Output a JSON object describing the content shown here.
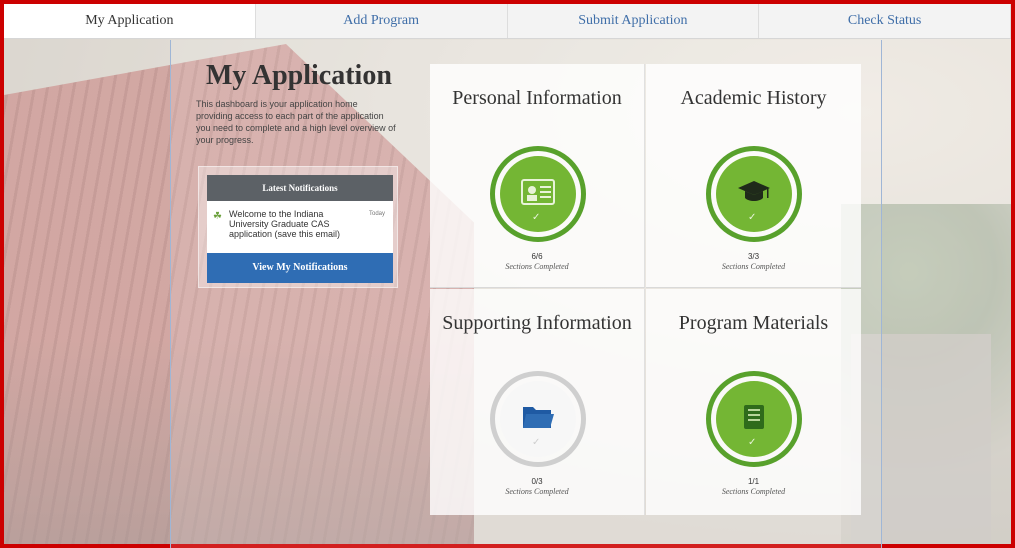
{
  "tabs": [
    {
      "label": "My Application",
      "active": true
    },
    {
      "label": "Add Program",
      "active": false
    },
    {
      "label": "Submit Application",
      "active": false
    },
    {
      "label": "Check Status",
      "active": false
    }
  ],
  "intro": {
    "title": "My Application",
    "description": "This dashboard is your application home providing access to each part of the application you need to complete and a high level overview of your progress."
  },
  "notifications": {
    "heading": "Latest Notifications",
    "item_text": "Welcome to the Indiana University Graduate CAS application (save this email)",
    "item_date": "Today",
    "button_label": "View My Notifications",
    "icon": "leaf-icon"
  },
  "tiles": [
    {
      "title": "Personal Information",
      "progress": "6/6",
      "status": "Sections Completed",
      "icon": "id-card-icon",
      "complete": true
    },
    {
      "title": "Academic History",
      "progress": "3/3",
      "status": "Sections Completed",
      "icon": "graduation-cap-icon",
      "complete": true
    },
    {
      "title": "Supporting Information",
      "progress": "0/3",
      "status": "Sections Completed",
      "icon": "folder-icon",
      "complete": false
    },
    {
      "title": "Program Materials",
      "progress": "1/1",
      "status": "Sections Completed",
      "icon": "book-icon",
      "complete": true
    }
  ],
  "colors": {
    "accent_blue": "#2f6db4",
    "complete_green": "#74b634",
    "frame_red": "#cc0000"
  }
}
